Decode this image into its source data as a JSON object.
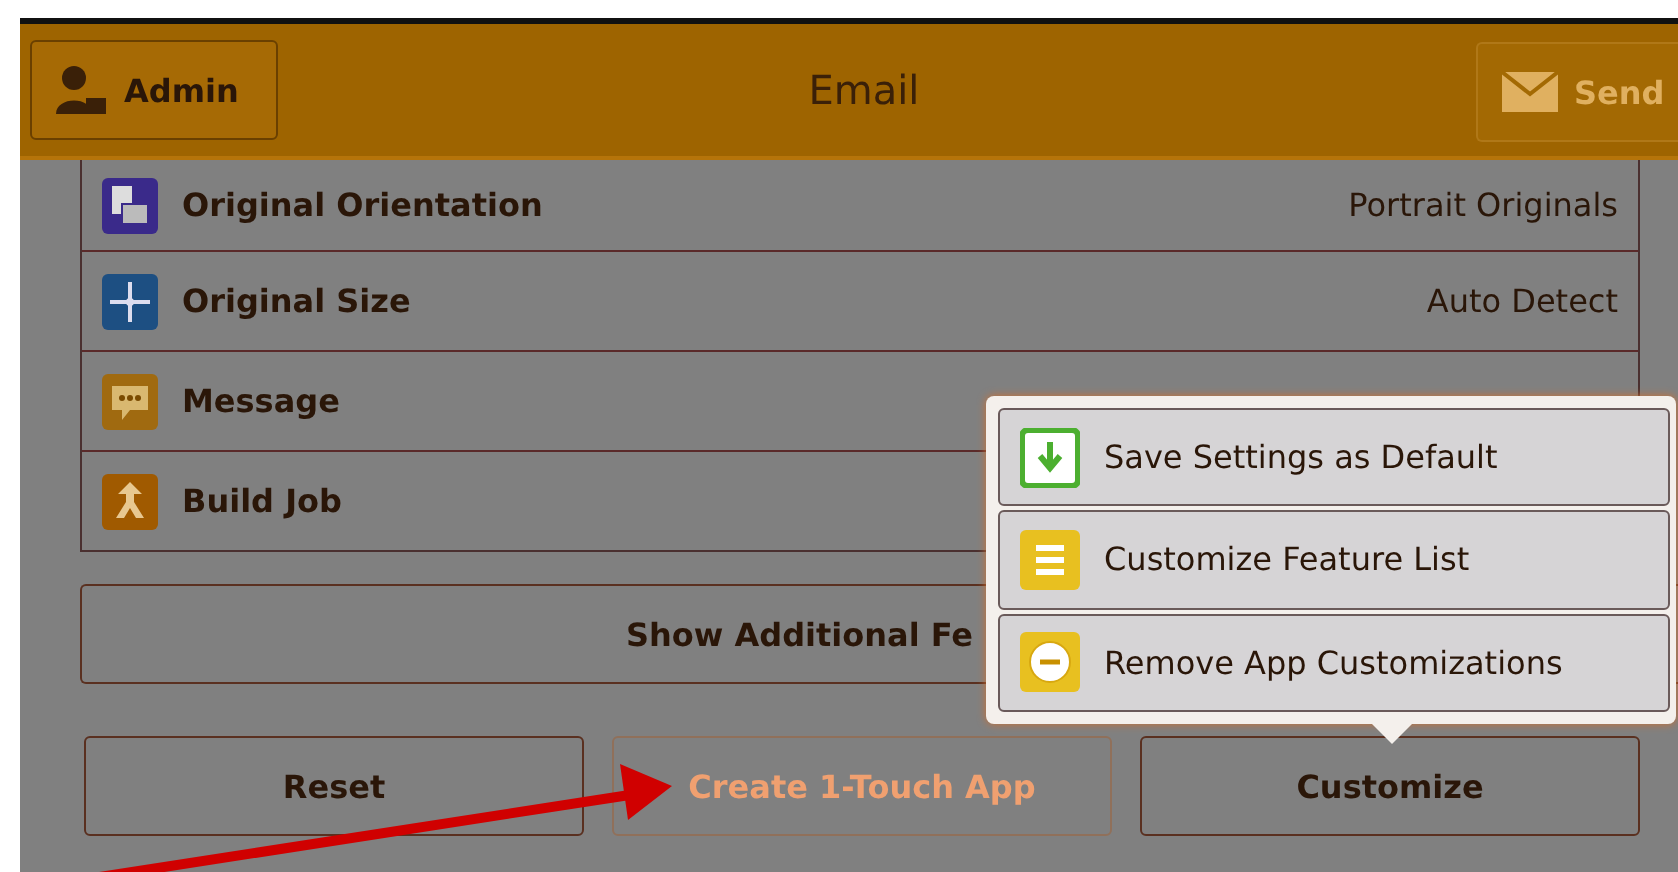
{
  "header": {
    "admin_button": "Admin",
    "title": "Email",
    "send_button": {
      "label": "Send",
      "disabled": true
    }
  },
  "features": [
    {
      "label": "Original Orientation",
      "value": "Portrait Originals"
    },
    {
      "label": "Original Size",
      "value": "Auto Detect"
    },
    {
      "label": "Message"
    },
    {
      "label": "Build Job"
    }
  ],
  "show_more_button": "Show Additional Fe",
  "actions": [
    {
      "label": "Reset",
      "disabled": false
    },
    {
      "label": "Create 1-Touch App",
      "disabled": true
    },
    {
      "label": "Customize",
      "disabled": false
    }
  ],
  "customize_menu": [
    {
      "label": "Save Settings as Default"
    },
    {
      "label": "Customize Feature List"
    },
    {
      "label": "Remove App Customizations"
    }
  ]
}
